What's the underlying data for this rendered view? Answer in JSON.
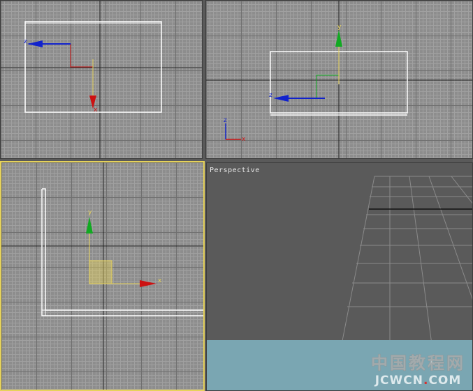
{
  "viewports": {
    "top": {
      "label": ""
    },
    "front": {
      "label": ""
    },
    "left": {
      "label": ""
    },
    "perspective": {
      "label": "Perspective"
    }
  },
  "axes": {
    "x": "x",
    "y": "y",
    "z": "z"
  },
  "colors": {
    "active_border": "#e6d25a",
    "x_axis": "#cc1111",
    "y_axis": "#11aa22",
    "z_axis": "#1122cc",
    "grid_bg": "#8d8d8d",
    "perspective_bg": "#5a5a5a",
    "ground": "#7aa6b2"
  },
  "watermark": {
    "cn": "中国教程网",
    "en": "JCWCN",
    "dot": ".",
    "com": "COM"
  }
}
